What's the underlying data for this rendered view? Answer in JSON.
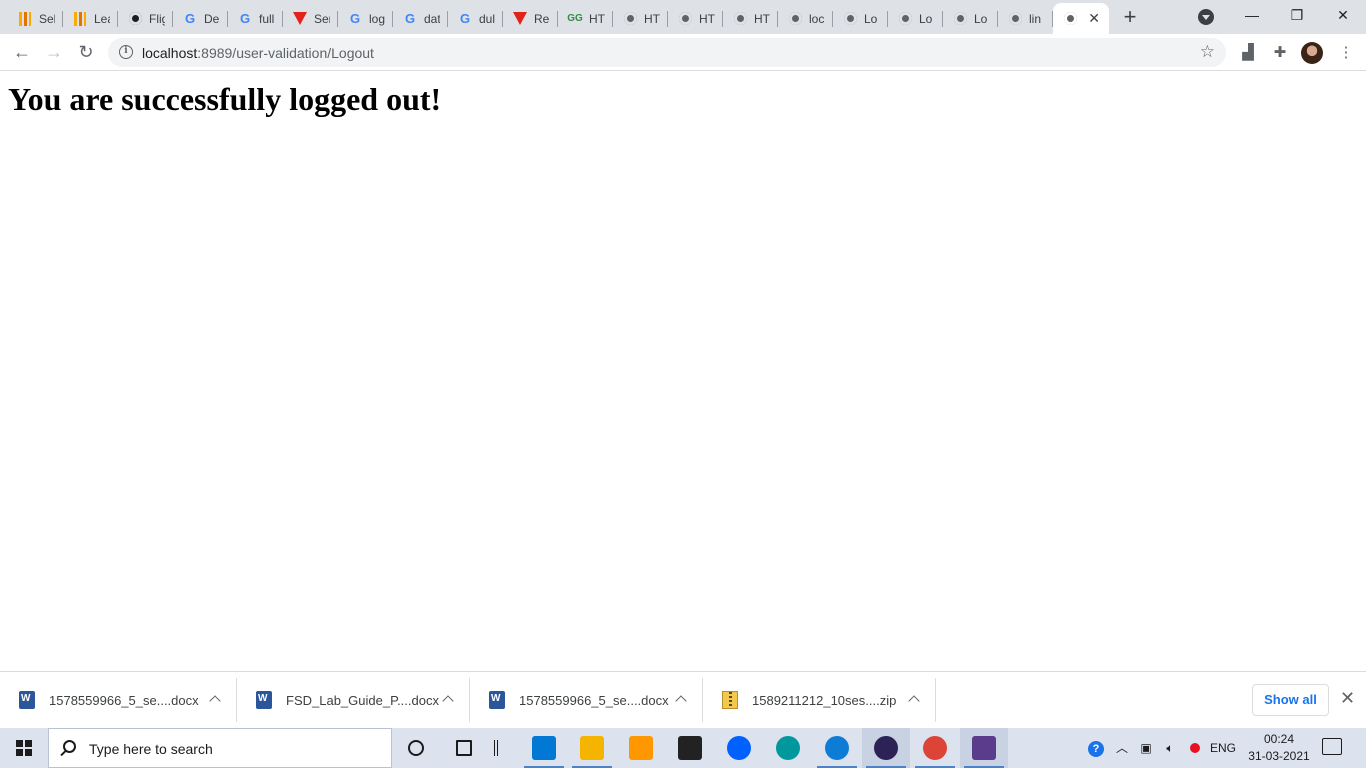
{
  "browser": {
    "tabs": [
      {
        "title": "Sel",
        "icon": "analytics-icon"
      },
      {
        "title": "Lea",
        "icon": "analytics-icon"
      },
      {
        "title": "Flig",
        "icon": "github-icon"
      },
      {
        "title": "De",
        "icon": "google-icon"
      },
      {
        "title": "full",
        "icon": "google-icon"
      },
      {
        "title": "Ser",
        "icon": "vivaldi-icon"
      },
      {
        "title": "log",
        "icon": "google-icon"
      },
      {
        "title": "dat",
        "icon": "google-icon"
      },
      {
        "title": "dul",
        "icon": "google-icon"
      },
      {
        "title": "Rea",
        "icon": "vivaldi-icon"
      },
      {
        "title": "HT",
        "icon": "geeksforgeeks-icon"
      },
      {
        "title": "HT",
        "icon": "globe-icon"
      },
      {
        "title": "HT",
        "icon": "globe-icon"
      },
      {
        "title": "HT",
        "icon": "globe-icon"
      },
      {
        "title": "loc",
        "icon": "globe-icon"
      },
      {
        "title": "Lo",
        "icon": "globe-icon"
      },
      {
        "title": "Lo",
        "icon": "globe-icon"
      },
      {
        "title": "Lo",
        "icon": "globe-icon"
      },
      {
        "title": "lin",
        "icon": "globe-icon"
      }
    ],
    "active_tab": {
      "icon": "globe-icon",
      "close": "✕"
    },
    "new_tab": "+",
    "window_controls": {
      "minimize": "—",
      "restore": "❐",
      "close": "✕"
    },
    "url_host": "localhost",
    "url_rest": ":8989/user-validation/Logout"
  },
  "page": {
    "heading": "You are successfully logged out!"
  },
  "downloads": {
    "items": [
      {
        "name": "1578559966_5_se....docx",
        "type": "word"
      },
      {
        "name": "FSD_Lab_Guide_P....docx",
        "type": "word"
      },
      {
        "name": "1578559966_5_se....docx",
        "type": "word"
      },
      {
        "name": "1589211212_10ses....zip",
        "type": "zip"
      }
    ],
    "show_all": "Show all",
    "close": "✕"
  },
  "taskbar": {
    "search_placeholder": "Type here to search",
    "apps": [
      {
        "name": "cortana-icon",
        "color": "#1b1b1b"
      },
      {
        "name": "task-view-icon",
        "color": "#1b1b1b"
      },
      {
        "name": "divider-icon",
        "color": "#1b1b1b"
      },
      {
        "name": "mail-icon",
        "color": "#0078d4"
      },
      {
        "name": "file-explorer-icon",
        "color": "#f4b400"
      },
      {
        "name": "sublime-text-icon",
        "color": "#ff9800"
      },
      {
        "name": "store-icon",
        "color": "#222222"
      },
      {
        "name": "dropbox-icon",
        "color": "#0061fe"
      },
      {
        "name": "arduino-icon",
        "color": "#00979d"
      },
      {
        "name": "edge-icon",
        "color": "#0c7cd5"
      },
      {
        "name": "eclipse-icon",
        "color": "#2c2255"
      },
      {
        "name": "chrome-icon",
        "color": "#db4437"
      },
      {
        "name": "app-icon",
        "color": "#5a3b8c"
      }
    ],
    "language": "ENG",
    "time": "00:24",
    "date": "31-03-2021"
  }
}
